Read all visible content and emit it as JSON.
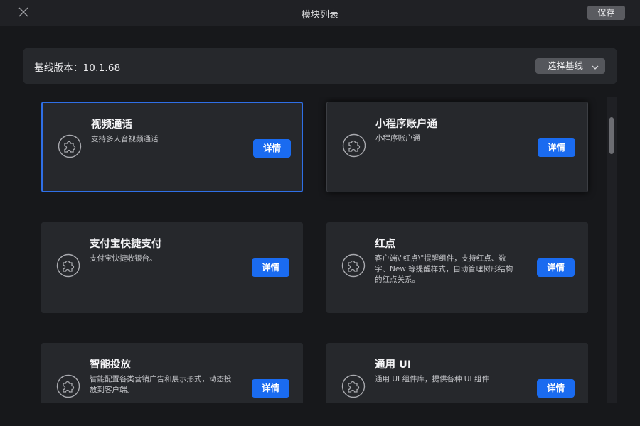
{
  "window": {
    "title": "模块列表",
    "save_label": "保存",
    "close_icon": "close-icon"
  },
  "baseline": {
    "label": "基线版本：10.1.68",
    "select_label": "选择基线",
    "select_icon": "chevron-down-icon"
  },
  "modules": [
    {
      "title": "视频通话",
      "desc": "支持多人音视频通话",
      "button": "详情",
      "icon": "puzzle-icon",
      "state": "selected"
    },
    {
      "title": "小程序账户通",
      "desc": "小程序账户通",
      "button": "详情",
      "icon": "puzzle-icon",
      "state": "hovered"
    },
    {
      "title": "支付宝快捷支付",
      "desc": "支付宝快捷收银台。",
      "button": "详情",
      "icon": "puzzle-icon",
      "state": "normal"
    },
    {
      "title": "红点",
      "desc": "客户端\\\"红点\\\"提醒组件，支持红点、数字、New 等提醒样式，自动管理树形结构的红点关系。",
      "button": "详情",
      "icon": "puzzle-icon",
      "state": "normal"
    },
    {
      "title": "智能投放",
      "desc": "智能配置各类营销广告和展示形式，动态投放到客户端。",
      "button": "详情",
      "icon": "puzzle-icon",
      "state": "normal"
    },
    {
      "title": "通用 UI",
      "desc": "通用 UI 组件库，提供各种 UI 组件",
      "button": "详情",
      "icon": "puzzle-icon",
      "state": "normal"
    }
  ],
  "colors": {
    "accent": "#1a6bf0",
    "selected_border": "#2f6fe6",
    "card_bg": "#26282c",
    "window_bg": "#17181b"
  }
}
